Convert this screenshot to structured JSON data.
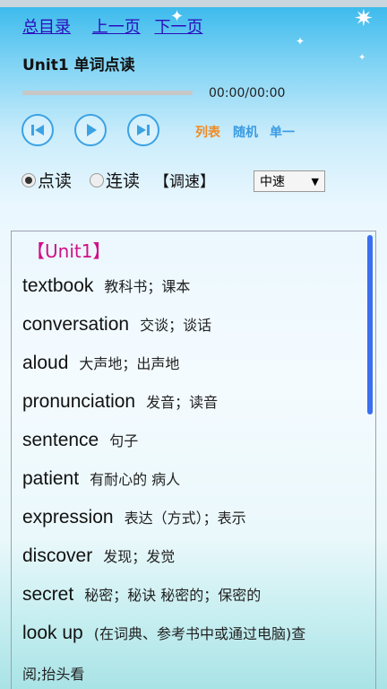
{
  "nav": {
    "home": "总目录",
    "prev": "上一页",
    "next": "下一页"
  },
  "title": "Unit1 单词点读",
  "player": {
    "progress_fraction": 0,
    "time": "00:00/00:00"
  },
  "modes": {
    "list": "列表",
    "random": "随机",
    "single": "单一",
    "list_color": "#f08a21",
    "other_color": "#3a9be2"
  },
  "read": {
    "point": "点读",
    "continuous": "连读",
    "speed_label": "【调速】",
    "speed_value": "中速"
  },
  "unit_heading": "【Unit1】",
  "words": [
    {
      "word": "textbook",
      "meaning": "教科书；课本"
    },
    {
      "word": "conversation",
      "meaning": "交谈；谈话"
    },
    {
      "word": "aloud",
      "meaning": "大声地；出声地"
    },
    {
      "word": "pronunciation",
      "meaning": "发音；读音"
    },
    {
      "word": "sentence",
      "meaning": "句子"
    },
    {
      "word": "patient",
      "meaning": "有耐心的 病人"
    },
    {
      "word": "expression",
      "meaning": "表达（方式）；表示"
    },
    {
      "word": "discover",
      "meaning": "发现；发觉"
    },
    {
      "word": "secret",
      "meaning": "秘密；秘诀 秘密的；保密的"
    },
    {
      "word": "look up",
      "meaning": "(在词典、参考书中或通过电脑)查"
    }
  ],
  "wrap_text": "阅;抬头看"
}
